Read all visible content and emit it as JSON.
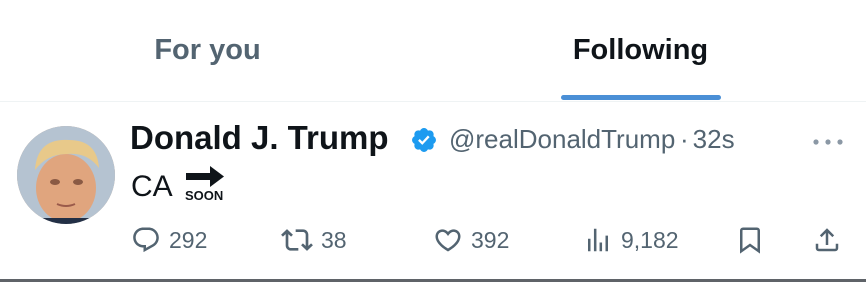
{
  "tabs": [
    {
      "label": "For you",
      "active": false
    },
    {
      "label": "Following",
      "active": true
    }
  ],
  "accent_color": "#1d9bf0",
  "tweet": {
    "author_name": "Donald J. Trump",
    "verified": true,
    "handle": "@realDonaldTrump",
    "separator": "·",
    "time": "32s",
    "text": "CA",
    "emoji": {
      "name": "soon-arrow-icon",
      "label": "SOON"
    },
    "stats": {
      "replies": "292",
      "retweets": "38",
      "likes": "392",
      "views": "9,182"
    }
  }
}
